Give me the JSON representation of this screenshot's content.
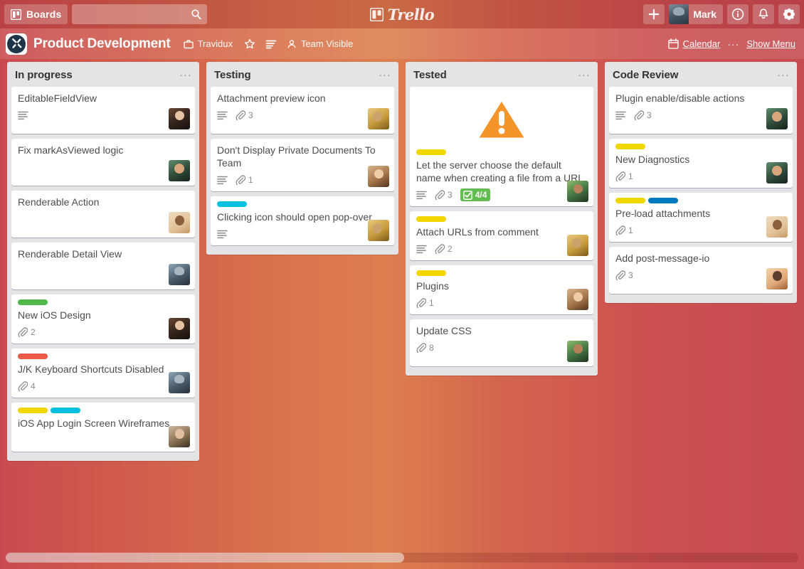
{
  "topbar": {
    "boards_label": "Boards",
    "boards_icon": "board-grid-icon",
    "search_placeholder": "",
    "search_value": "",
    "search_icon": "search-icon",
    "brand_name": "Trello",
    "add_label": "+",
    "user_name": "Mark",
    "info_icon": "info-icon",
    "notification_icon": "bell-icon",
    "settings_icon": "gear-icon"
  },
  "board_header": {
    "logo_icon": "board-logo-icon",
    "title": "Product Development",
    "organization": "Travidux",
    "organization_icon": "briefcase-icon",
    "star_icon": "star-icon",
    "subscribe_icon": "list-lines-icon",
    "visibility": "Team Visible",
    "visibility_icon": "person-icon",
    "calendar_label": "Calendar",
    "calendar_icon": "calendar-icon",
    "more_dots": "···",
    "show_menu_label": "Show Menu"
  },
  "colors": {
    "label_green": "#51b84a",
    "label_red": "#eb5a46",
    "label_yellow": "#f2d600",
    "label_sky": "#00c2e0",
    "label_blue": "#0079bf",
    "checklist_complete": "#61bd4f",
    "list_background": "#e2e4e6",
    "card_background": "#ffffff"
  },
  "lists": [
    {
      "title": "In progress",
      "menu_icon": "list-menu-icon",
      "cards": [
        {
          "title": "EditableFieldView",
          "labels": [],
          "description": true,
          "attachments": null,
          "checklist": null,
          "avatar": "av-a"
        },
        {
          "title": "Fix markAsViewed logic",
          "labels": [],
          "description": false,
          "attachments": null,
          "checklist": null,
          "avatar": "av-b"
        },
        {
          "title": "Renderable Action",
          "labels": [],
          "description": false,
          "attachments": null,
          "checklist": null,
          "avatar": "av-c"
        },
        {
          "title": "Renderable Detail View",
          "labels": [],
          "description": false,
          "attachments": null,
          "checklist": null,
          "avatar": "av-d"
        },
        {
          "title": "New iOS Design",
          "labels": [
            "#51b84a"
          ],
          "description": false,
          "attachments": "2",
          "checklist": null,
          "avatar": "av-a"
        },
        {
          "title": "J/K Keyboard Shortcuts Disabled",
          "labels": [
            "#eb5a46"
          ],
          "description": false,
          "attachments": "4",
          "checklist": null,
          "avatar": "av-d"
        },
        {
          "title": "iOS App Login Screen Wireframes",
          "labels": [
            "#f2d600",
            "#00c2e0"
          ],
          "description": false,
          "attachments": null,
          "checklist": null,
          "avatar": "av-f"
        }
      ]
    },
    {
      "title": "Testing",
      "menu_icon": "list-menu-icon",
      "cards": [
        {
          "title": "Attachment preview icon",
          "labels": [],
          "description": true,
          "attachments": "3",
          "checklist": null,
          "avatar": "av-e"
        },
        {
          "title": "Don't Display Private Documents To Team",
          "labels": [],
          "description": true,
          "attachments": "1",
          "checklist": null,
          "avatar": "av-h"
        },
        {
          "title": "Clicking icon should open pop-over",
          "labels": [
            "#00c2e0"
          ],
          "description": true,
          "attachments": null,
          "checklist": null,
          "avatar": "av-e"
        }
      ]
    },
    {
      "title": "Tested",
      "menu_icon": "list-menu-icon",
      "cards": [
        {
          "title": "Let the server choose the default name when creating a file from a URL",
          "labels": [
            "#f2d600"
          ],
          "description": true,
          "attachments": "3",
          "checklist": "4/4",
          "cover": "warning-triangle-icon",
          "avatar": "av-g"
        },
        {
          "title": "Attach URLs from comment",
          "labels": [
            "#f2d600"
          ],
          "description": true,
          "attachments": "2",
          "checklist": null,
          "avatar": "av-e"
        },
        {
          "title": "Plugins",
          "labels": [
            "#f2d600"
          ],
          "description": false,
          "attachments": "1",
          "checklist": null,
          "avatar": "av-h"
        },
        {
          "title": "Update CSS",
          "labels": [],
          "description": false,
          "attachments": "8",
          "checklist": null,
          "avatar": "av-g"
        }
      ]
    },
    {
      "title": "Code Review",
      "menu_icon": "list-menu-icon",
      "cards": [
        {
          "title": "Plugin enable/disable actions",
          "labels": [],
          "description": true,
          "attachments": "3",
          "checklist": null,
          "avatar": "av-b"
        },
        {
          "title": "New Diagnostics",
          "labels": [
            "#f2d600"
          ],
          "description": false,
          "attachments": "1",
          "checklist": null,
          "avatar": "av-b"
        },
        {
          "title": "Pre-load attachments",
          "labels": [
            "#f2d600",
            "#0079bf"
          ],
          "description": false,
          "attachments": "1",
          "checklist": null,
          "avatar": "av-c"
        },
        {
          "title": "Add post-message-io",
          "labels": [],
          "description": false,
          "attachments": "3",
          "checklist": null,
          "avatar": "av-i"
        }
      ]
    }
  ],
  "scrollbar": {
    "orientation": "horizontal"
  }
}
